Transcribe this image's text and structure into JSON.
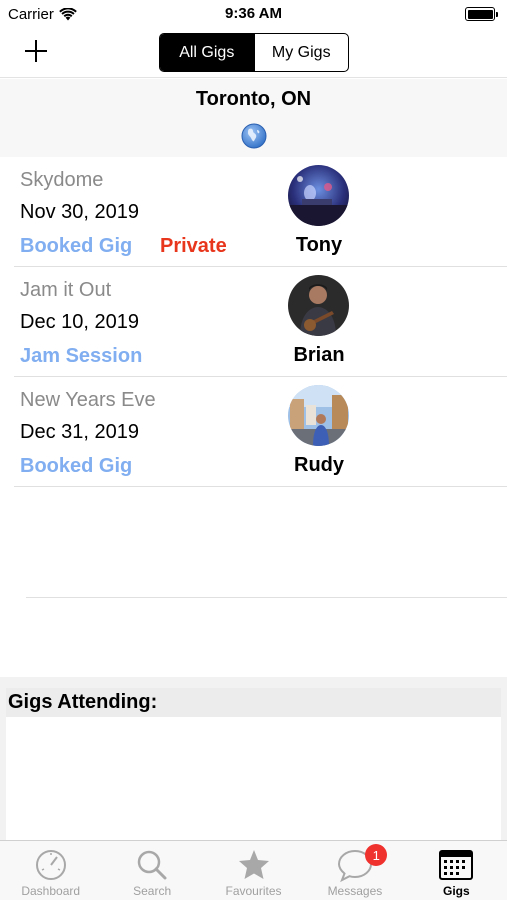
{
  "status_bar": {
    "carrier": "Carrier",
    "time": "9:36 AM",
    "battery_level": 1.0
  },
  "nav": {
    "segments": [
      {
        "label": "All Gigs",
        "selected": true
      },
      {
        "label": "My Gigs",
        "selected": false
      }
    ]
  },
  "location": {
    "title": "Toronto, ON"
  },
  "gigs": [
    {
      "venue": "Skydome",
      "date": "Nov 30, 2019",
      "type": "Booked Gig",
      "private_label": "Private",
      "host": "Tony"
    },
    {
      "venue": "Jam it Out",
      "date": "Dec 10, 2019",
      "type": "Jam Session",
      "private_label": "",
      "host": "Brian"
    },
    {
      "venue": "New Years Eve",
      "date": "Dec 31, 2019",
      "type": "Booked Gig",
      "private_label": "",
      "host": "Rudy"
    }
  ],
  "attending": {
    "header": "Gigs Attending:"
  },
  "tab_bar": {
    "tabs": [
      {
        "label": "Dashboard",
        "icon": "dashboard-gauge-icon",
        "active": false
      },
      {
        "label": "Search",
        "icon": "search-icon",
        "active": false
      },
      {
        "label": "Favourites",
        "icon": "star-icon",
        "active": false
      },
      {
        "label": "Messages",
        "icon": "chat-bubble-icon",
        "active": false,
        "badge": "1"
      },
      {
        "label": "Gigs",
        "icon": "calendar-grid-icon",
        "active": true
      }
    ]
  },
  "colors": {
    "link_blue": "#80aef0",
    "private_red": "#e8361d",
    "badge_red": "#f0322f"
  }
}
